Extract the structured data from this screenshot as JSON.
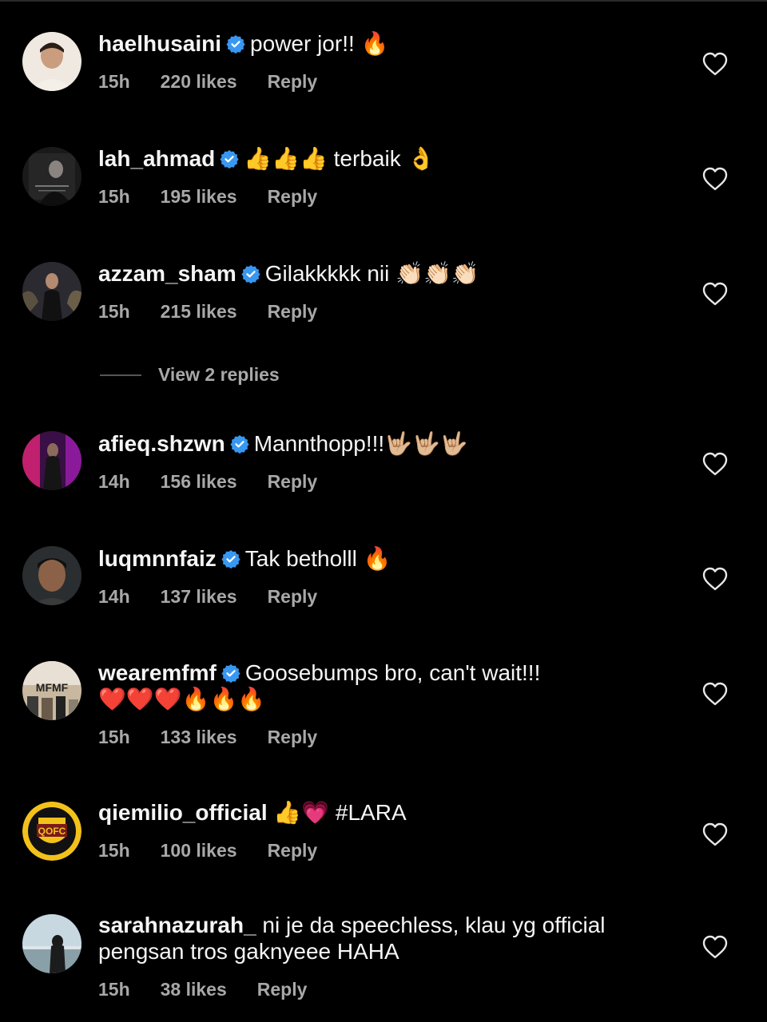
{
  "comments": [
    {
      "username": "haelhusaini",
      "text": "power jor!! 🔥",
      "time": "15h",
      "likes": "220 likes",
      "reply": "Reply",
      "verified": true,
      "avatar_icon": "avatar-photo"
    },
    {
      "username": "lah_ahmad",
      "text": "👍👍👍 terbaik 👌",
      "time": "15h",
      "likes": "195 likes",
      "reply": "Reply",
      "verified": true,
      "avatar_icon": "avatar-photo"
    },
    {
      "username": "azzam_sham",
      "text": "Gilakkkkk nii 👏🏻👏🏻👏🏻",
      "time": "15h",
      "likes": "215 likes",
      "reply": "Reply",
      "verified": true,
      "avatar_icon": "avatar-photo"
    },
    {
      "username": "afieq.shzwn",
      "text": "Mannthopp!!!🤟🏼🤟🏼🤟🏼",
      "time": "14h",
      "likes": "156 likes",
      "reply": "Reply",
      "verified": true,
      "avatar_icon": "avatar-photo"
    },
    {
      "username": "luqmnnfaiz",
      "text": "Tak betholll 🔥",
      "time": "14h",
      "likes": "137 likes",
      "reply": "Reply",
      "verified": true,
      "avatar_icon": "avatar-photo"
    },
    {
      "username": "wearemfmf",
      "text": "Goosebumps bro, can't wait!!!",
      "text2": "❤️❤️❤️🔥🔥🔥",
      "time": "15h",
      "likes": "133 likes",
      "reply": "Reply",
      "verified": true,
      "avatar_icon": "avatar-photo",
      "avatar_text": "MFMF"
    },
    {
      "username": "qiemilio_official",
      "text": "👍💗 #LARA",
      "time": "15h",
      "likes": "100 likes",
      "reply": "Reply",
      "verified": false,
      "avatar_icon": "qofc-logo",
      "avatar_text": "QOFC"
    },
    {
      "username": "sarahnazurah_",
      "text": "ni je da speechless, klau yg official",
      "text2": "pengsan tros gaknyeee HAHA",
      "time": "15h",
      "likes": "38 likes",
      "reply": "Reply",
      "verified": false,
      "avatar_icon": "avatar-photo"
    }
  ],
  "view_replies": "View 2 replies",
  "colors": {
    "background": "#000000",
    "text": "#f5f5f5",
    "meta": "#a8a8a8",
    "verified": "#3897f0"
  },
  "icons": {
    "verified": "verified-badge-icon",
    "like": "heart-outline-icon"
  }
}
